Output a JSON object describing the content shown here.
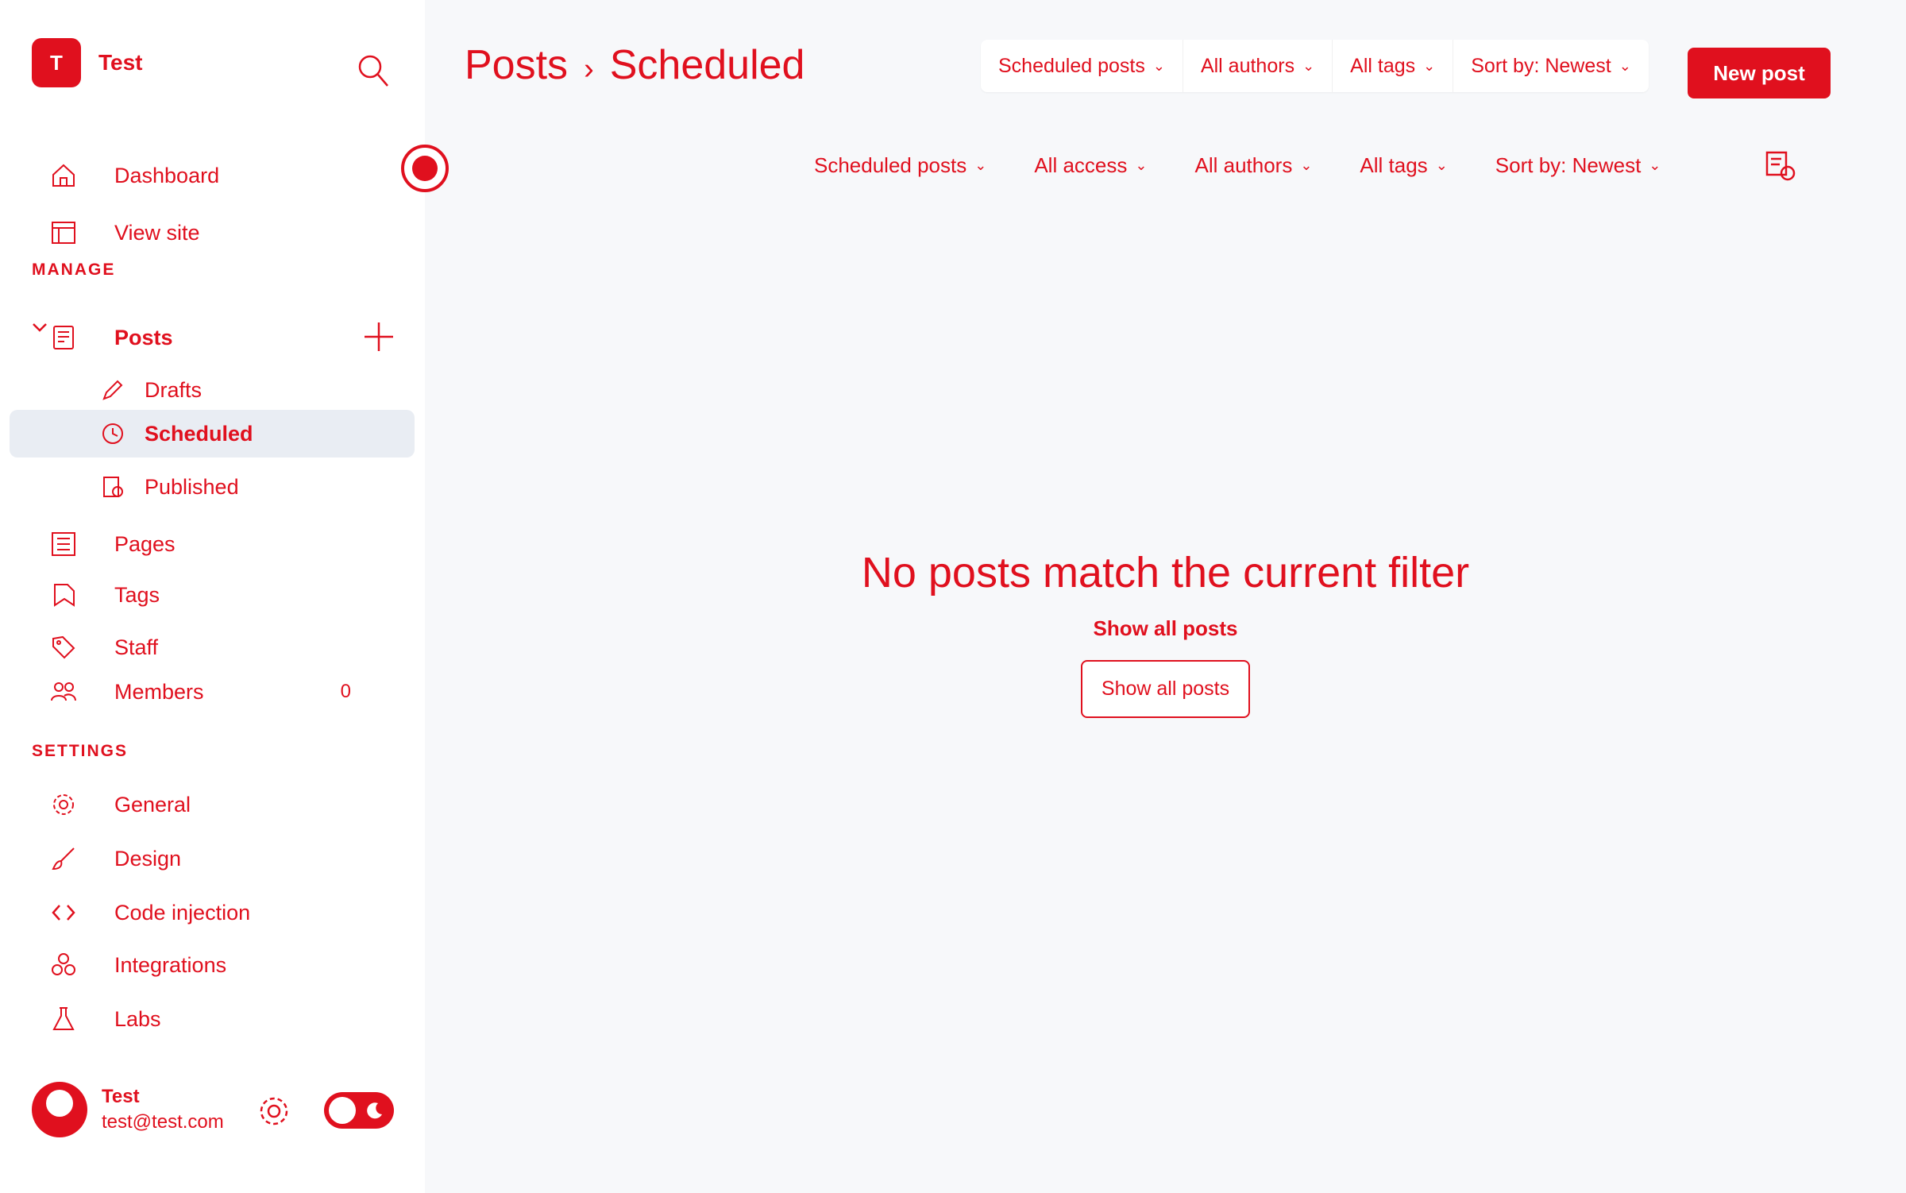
{
  "brand": {
    "name": "Test",
    "logo_initials": "T"
  },
  "sidebar": {
    "top_items": [
      {
        "label": "Dashboard",
        "icon": "home-icon"
      },
      {
        "label": "View site",
        "icon": "browser-icon"
      }
    ],
    "manage_label": "MANAGE",
    "posts": {
      "label": "Posts",
      "subitems": [
        {
          "label": "Drafts",
          "icon": "pencil-icon"
        },
        {
          "label": "Scheduled",
          "icon": "clock-icon"
        },
        {
          "label": "Published",
          "icon": "published-icon"
        }
      ]
    },
    "manage_items": [
      {
        "label": "Pages",
        "icon": "pages-icon"
      },
      {
        "label": "Tags",
        "icon": "tag-icon"
      },
      {
        "label": "Staff",
        "icon": "staff-icon"
      },
      {
        "label": "Members",
        "icon": "members-icon",
        "count": "0"
      }
    ],
    "settings_label": "SETTINGS",
    "settings_items": [
      {
        "label": "General",
        "icon": "gear-icon"
      },
      {
        "label": "Design",
        "icon": "brush-icon"
      },
      {
        "label": "Code injection",
        "icon": "code-icon"
      },
      {
        "label": "Integrations",
        "icon": "integrations-icon"
      },
      {
        "label": "Labs",
        "icon": "flask-icon"
      }
    ],
    "user": {
      "name": "Test",
      "email": "test@test.com"
    }
  },
  "header": {
    "title_parent": "Posts",
    "title_separator": "›",
    "title_current": "Scheduled",
    "filters": [
      "Scheduled posts",
      "All authors",
      "All tags",
      "Sort by: Newest"
    ],
    "new_post_label": "New post"
  },
  "sub_filters": [
    "Scheduled posts",
    "All access",
    "All authors",
    "All tags",
    "Sort by: Newest"
  ],
  "empty_state": {
    "title": "No posts match the current filter",
    "subtitle": "Show all posts",
    "button_label": "Show all posts"
  },
  "colors": {
    "accent": "#e0101e",
    "main_bg": "#f7f8fa",
    "active_bg": "#e9edf3"
  }
}
